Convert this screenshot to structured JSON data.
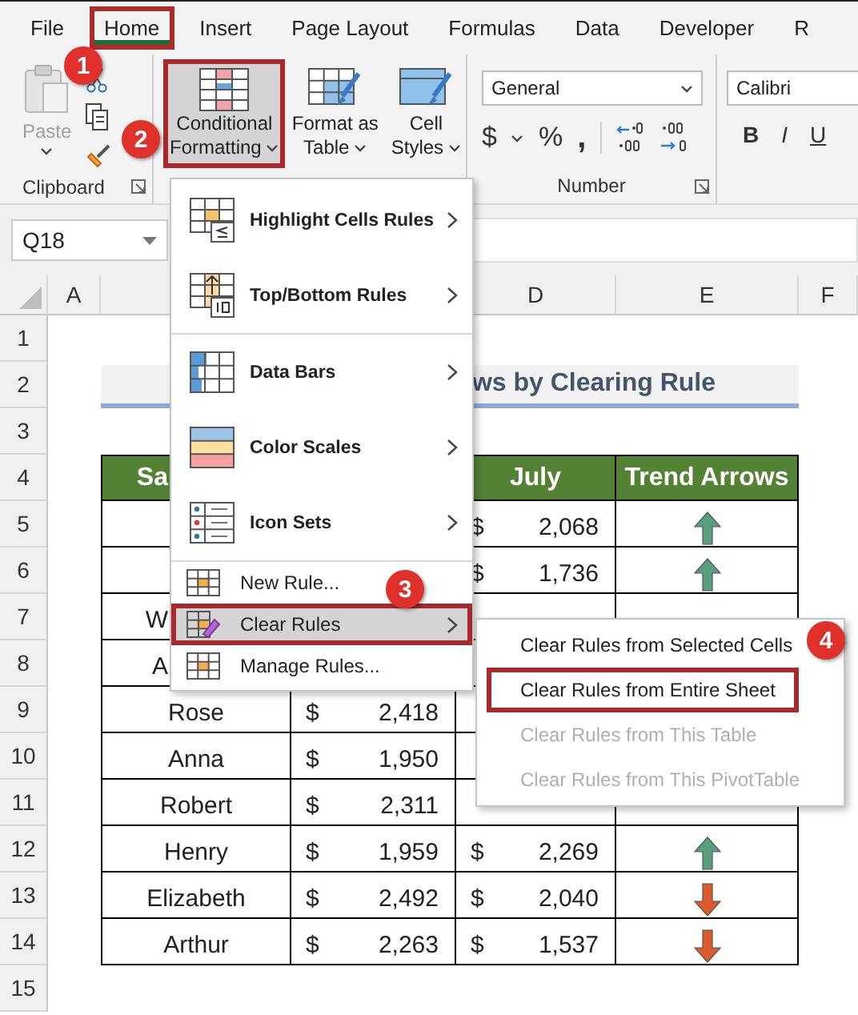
{
  "ribbon_tabs": [
    {
      "label": "File",
      "selected": false,
      "highlighted": false
    },
    {
      "label": "Home",
      "selected": true,
      "highlighted": true
    },
    {
      "label": "Insert",
      "selected": false,
      "highlighted": false
    },
    {
      "label": "Page Layout",
      "selected": false,
      "highlighted": false
    },
    {
      "label": "Formulas",
      "selected": false,
      "highlighted": false
    },
    {
      "label": "Data",
      "selected": false,
      "highlighted": false
    },
    {
      "label": "Developer",
      "selected": false,
      "highlighted": false
    },
    {
      "label": "R",
      "selected": false,
      "highlighted": false
    }
  ],
  "clipboard": {
    "label": "Clipboard",
    "paste": {
      "label": "Paste",
      "disabled": true
    }
  },
  "styles": {
    "buttons": [
      {
        "kind": "conditional",
        "lines": [
          "Conditional",
          "Formatting"
        ],
        "pressed": true,
        "highlighted": true
      },
      {
        "kind": "table",
        "lines": [
          "Format as",
          "Table"
        ],
        "pressed": false,
        "highlighted": false
      },
      {
        "kind": "cell",
        "lines": [
          "Cell",
          "Styles"
        ],
        "pressed": false,
        "highlighted": false
      }
    ]
  },
  "number": {
    "label": "Number",
    "format": "General",
    "currency": "$",
    "percent": "%",
    "comma": ","
  },
  "font": {
    "name": "Calibri",
    "bold": "B",
    "italic": "I",
    "underline": "U"
  },
  "name_box": "Q18",
  "column_headers": {
    "a": "A",
    "d": "D",
    "e": "E",
    "f": "F"
  },
  "rows": [
    {
      "number": "1",
      "kind": "blank"
    },
    {
      "number": "2",
      "kind": "title",
      "title": "ws by Clearing Rule"
    },
    {
      "number": "3",
      "kind": "blank"
    },
    {
      "number": "4",
      "kind": "header",
      "b": {
        "text": "Sa",
        "kind": "partial"
      },
      "d": {
        "text": "July"
      },
      "e": {
        "text": "Trend Arrows"
      }
    },
    {
      "number": "5",
      "kind": "data",
      "d": {
        "currency": "$",
        "amount": "2,068"
      },
      "e": {
        "rising": true
      }
    },
    {
      "number": "6",
      "kind": "data",
      "d": {
        "currency": "$",
        "amount": "1,736"
      },
      "e": {
        "rising": true
      }
    },
    {
      "number": "7",
      "kind": "data",
      "b": {
        "text": "W",
        "kind": "partial"
      }
    },
    {
      "number": "8",
      "kind": "data",
      "b": {
        "text": "A",
        "kind": "partial"
      }
    },
    {
      "number": "9",
      "kind": "data",
      "b": {
        "text": "Rose"
      },
      "c": {
        "currency": "$",
        "amount": "2,418"
      }
    },
    {
      "number": "10",
      "kind": "data",
      "b": {
        "text": "Anna"
      },
      "c": {
        "currency": "$",
        "amount": "1,950"
      }
    },
    {
      "number": "11",
      "kind": "data",
      "b": {
        "text": "Robert"
      },
      "c": {
        "currency": "$",
        "amount": "2,311"
      }
    },
    {
      "number": "12",
      "kind": "data",
      "b": {
        "text": "Henry"
      },
      "c": {
        "currency": "$",
        "amount": "1,959"
      },
      "d": {
        "currency": "$",
        "amount": "2,269"
      },
      "e": {
        "rising": true
      }
    },
    {
      "number": "13",
      "kind": "data",
      "b": {
        "text": "Elizabeth"
      },
      "c": {
        "currency": "$",
        "amount": "2,492"
      },
      "d": {
        "currency": "$",
        "amount": "2,040"
      },
      "e": {
        "rising": false
      }
    },
    {
      "number": "14",
      "kind": "data",
      "b": {
        "text": "Arthur"
      },
      "c": {
        "currency": "$",
        "amount": "2,263"
      },
      "d": {
        "currency": "$",
        "amount": "1,537"
      },
      "e": {
        "rising": false
      }
    },
    {
      "number": "15",
      "kind": "blank"
    }
  ],
  "cf_menu": {
    "sections": [
      [
        {
          "label": "Highlight Cells Rules",
          "kind": "large",
          "submenu": true,
          "selected": false,
          "highlighted": false
        },
        {
          "label": "Top/Bottom Rules",
          "kind": "large",
          "submenu": true,
          "selected": false,
          "highlighted": false
        }
      ],
      [
        {
          "label": "Data Bars",
          "kind": "large",
          "submenu": true,
          "selected": false,
          "highlighted": false
        },
        {
          "label": "Color Scales",
          "kind": "large",
          "submenu": true,
          "selected": false,
          "highlighted": false
        },
        {
          "label": "Icon Sets",
          "kind": "large",
          "submenu": true,
          "selected": false,
          "highlighted": false
        }
      ],
      [
        {
          "label": "New Rule...",
          "kind": "small",
          "submenu": false,
          "selected": false,
          "highlighted": false
        },
        {
          "label": "Clear Rules",
          "kind": "small",
          "submenu": true,
          "selected": true,
          "highlighted": true
        },
        {
          "label": "Manage Rules...",
          "kind": "small",
          "submenu": false,
          "selected": false,
          "highlighted": false
        }
      ]
    ]
  },
  "clear_submenu": {
    "items": [
      {
        "label": "Clear Rules from Selected Cells",
        "disabled": false,
        "highlighted": false
      },
      {
        "label": "Clear Rules from Entire Sheet",
        "disabled": false,
        "highlighted": true
      },
      {
        "label": "Clear Rules from This Table",
        "disabled": true,
        "highlighted": false
      },
      {
        "label": "Clear Rules from This PivotTable",
        "disabled": true,
        "highlighted": false
      }
    ]
  },
  "callouts": [
    {
      "number": "1"
    },
    {
      "number": "2"
    },
    {
      "number": "3"
    },
    {
      "number": "4"
    }
  ]
}
